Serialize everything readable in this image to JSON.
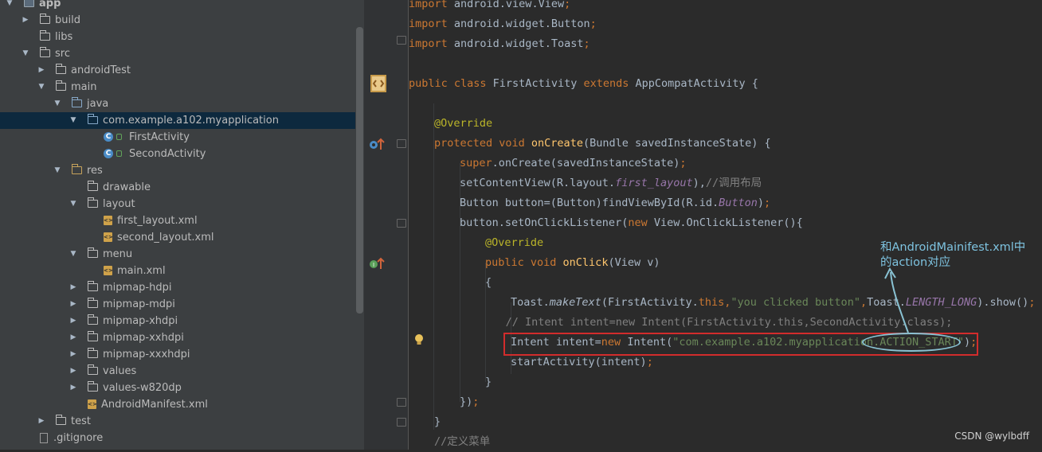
{
  "tree": [
    {
      "label": "app",
      "arrow": "▼",
      "icon": "module",
      "depth": 0,
      "bold": true
    },
    {
      "label": "build",
      "arrow": "▶",
      "icon": "folder",
      "depth": 1
    },
    {
      "label": "libs",
      "arrow": "",
      "icon": "folder",
      "depth": 1
    },
    {
      "label": "src",
      "arrow": "▼",
      "icon": "folder",
      "depth": 1
    },
    {
      "label": "androidTest",
      "arrow": "▶",
      "icon": "folder",
      "depth": 2
    },
    {
      "label": "main",
      "arrow": "▼",
      "icon": "folder",
      "depth": 2
    },
    {
      "label": "java",
      "arrow": "▼",
      "icon": "package-folder",
      "depth": 3
    },
    {
      "label": "com.example.a102.myapplication",
      "arrow": "▼",
      "icon": "package-folder",
      "depth": 4,
      "selected": true
    },
    {
      "label": "FirstActivity",
      "arrow": "",
      "icon": "class",
      "depth": 5
    },
    {
      "label": "SecondActivity",
      "arrow": "",
      "icon": "class",
      "depth": 5
    },
    {
      "label": "res",
      "arrow": "▼",
      "icon": "res-folder",
      "depth": 3
    },
    {
      "label": "drawable",
      "arrow": "",
      "icon": "folder",
      "depth": 4
    },
    {
      "label": "layout",
      "arrow": "▼",
      "icon": "folder",
      "depth": 4
    },
    {
      "label": "first_layout.xml",
      "arrow": "",
      "icon": "xml",
      "depth": 5
    },
    {
      "label": "second_layout.xml",
      "arrow": "",
      "icon": "xml",
      "depth": 5
    },
    {
      "label": "menu",
      "arrow": "▼",
      "icon": "folder",
      "depth": 4
    },
    {
      "label": "main.xml",
      "arrow": "",
      "icon": "xml",
      "depth": 5
    },
    {
      "label": "mipmap-hdpi",
      "arrow": "▶",
      "icon": "folder",
      "depth": 4
    },
    {
      "label": "mipmap-mdpi",
      "arrow": "▶",
      "icon": "folder",
      "depth": 4
    },
    {
      "label": "mipmap-xhdpi",
      "arrow": "▶",
      "icon": "folder",
      "depth": 4
    },
    {
      "label": "mipmap-xxhdpi",
      "arrow": "▶",
      "icon": "folder",
      "depth": 4
    },
    {
      "label": "mipmap-xxxhdpi",
      "arrow": "▶",
      "icon": "folder",
      "depth": 4
    },
    {
      "label": "values",
      "arrow": "▶",
      "icon": "folder",
      "depth": 4
    },
    {
      "label": "values-w820dp",
      "arrow": "▶",
      "icon": "folder",
      "depth": 4
    },
    {
      "label": "AndroidManifest.xml",
      "arrow": "",
      "icon": "xml",
      "depth": 4
    },
    {
      "label": "test",
      "arrow": "▶",
      "icon": "folder",
      "depth": 2
    },
    {
      "label": ".gitignore",
      "arrow": "",
      "icon": "file",
      "depth": 1
    }
  ],
  "code_lines": [
    {
      "indent": 0,
      "tokens": [
        [
          "kw",
          "import "
        ],
        [
          "",
          "android.view.View"
        ],
        [
          "kw",
          ";"
        ]
      ]
    },
    {
      "indent": 0,
      "tokens": [
        [
          "kw",
          "import "
        ],
        [
          "",
          "android.widget.Button"
        ],
        [
          "kw",
          ";"
        ]
      ]
    },
    {
      "indent": 0,
      "tokens": [
        [
          "kw",
          "import "
        ],
        [
          "",
          "android.widget.Toast"
        ],
        [
          "kw",
          ";"
        ]
      ]
    },
    {
      "indent": 0,
      "tokens": []
    },
    {
      "indent": 0,
      "tokens": [
        [
          "kw",
          "public class "
        ],
        [
          "",
          "FirstActivity "
        ],
        [
          "kw",
          "extends "
        ],
        [
          "",
          "AppCompatActivity {"
        ]
      ]
    },
    {
      "indent": 0,
      "tokens": []
    },
    {
      "indent": 1,
      "tokens": [
        [
          "an",
          "@Override"
        ]
      ]
    },
    {
      "indent": 1,
      "tokens": [
        [
          "kw",
          "protected void "
        ],
        [
          "fn",
          "onCreate"
        ],
        [
          "",
          "(Bundle savedInstanceState) {"
        ]
      ]
    },
    {
      "indent": 2,
      "tokens": [
        [
          "kw",
          "super"
        ],
        [
          "",
          "."
        ],
        [
          "",
          "onCreate(savedInstanceState)"
        ],
        [
          "kw",
          ";"
        ]
      ]
    },
    {
      "indent": 2,
      "tokens": [
        [
          "",
          "setContentView(R.layout."
        ],
        [
          "fi",
          "first_layout"
        ],
        [
          "",
          "),"
        ],
        [
          "cm",
          "//调用布局"
        ]
      ]
    },
    {
      "indent": 2,
      "tokens": [
        [
          "",
          "Button button=(Button)findViewById(R.id."
        ],
        [
          "fi",
          "Button"
        ],
        [
          "",
          ")"
        ],
        [
          "kw",
          ";"
        ]
      ]
    },
    {
      "indent": 2,
      "tokens": [
        [
          "",
          "button.setOnClickListener("
        ],
        [
          "kw",
          "new "
        ],
        [
          "",
          "View.OnClickListener(){"
        ]
      ]
    },
    {
      "indent": 3,
      "tokens": [
        [
          "an",
          "@Override"
        ]
      ]
    },
    {
      "indent": 3,
      "tokens": [
        [
          "kw",
          "public void "
        ],
        [
          "fn",
          "onClick"
        ],
        [
          "",
          "(View v)"
        ]
      ]
    },
    {
      "indent": 3,
      "tokens": [
        [
          "",
          "{"
        ]
      ]
    },
    {
      "indent": 4,
      "tokens": [
        [
          "",
          "Toast."
        ],
        [
          "it",
          "makeText"
        ],
        [
          "",
          "(FirstActivity."
        ],
        [
          "kw",
          "this"
        ],
        [
          "kw",
          ","
        ],
        [
          "st",
          "\"you clicked button\""
        ],
        [
          "kw",
          ","
        ],
        [
          "",
          "Toast."
        ],
        [
          "fi",
          "LENGTH_LONG"
        ],
        [
          "",
          ").show()"
        ],
        [
          "kw",
          ";"
        ]
      ]
    },
    {
      "indent": 3.8,
      "tokens": [
        [
          "cm",
          "// Intent intent=new Intent(FirstActivity.this,SecondActivity.class);"
        ]
      ]
    },
    {
      "indent": 4,
      "tokens": [
        [
          "",
          "Intent intent="
        ],
        [
          "kw",
          "new "
        ],
        [
          "",
          "Intent("
        ],
        [
          "st",
          "\"com.example.a102.myapplication.ACTION_START\""
        ],
        [
          "",
          ")"
        ],
        [
          "kw",
          ";"
        ]
      ]
    },
    {
      "indent": 4,
      "tokens": [
        [
          "",
          "startActivity(intent)"
        ],
        [
          "kw",
          ";"
        ]
      ]
    },
    {
      "indent": 3,
      "tokens": [
        [
          "",
          "}"
        ]
      ]
    },
    {
      "indent": 2,
      "tokens": [
        [
          "",
          "})"
        ],
        [
          "kw",
          ";"
        ]
      ]
    },
    {
      "indent": 1,
      "tokens": [
        [
          "",
          "}"
        ]
      ]
    },
    {
      "indent": 1,
      "tokens": [
        [
          "cm",
          "//定义菜单"
        ]
      ]
    }
  ],
  "annotation": {
    "line1": "和AndroidMainifest.xml中",
    "line2": "的action对应"
  },
  "watermark": "CSDN @wylbdff",
  "colors": {
    "keyword": "#cc7832",
    "string": "#6a8759",
    "annotation": "#bbb529",
    "method": "#ffc66d",
    "comment": "#808080",
    "field": "#9876aa",
    "highlight_box": "#d22c2c",
    "callout": "#7ec3e0"
  }
}
